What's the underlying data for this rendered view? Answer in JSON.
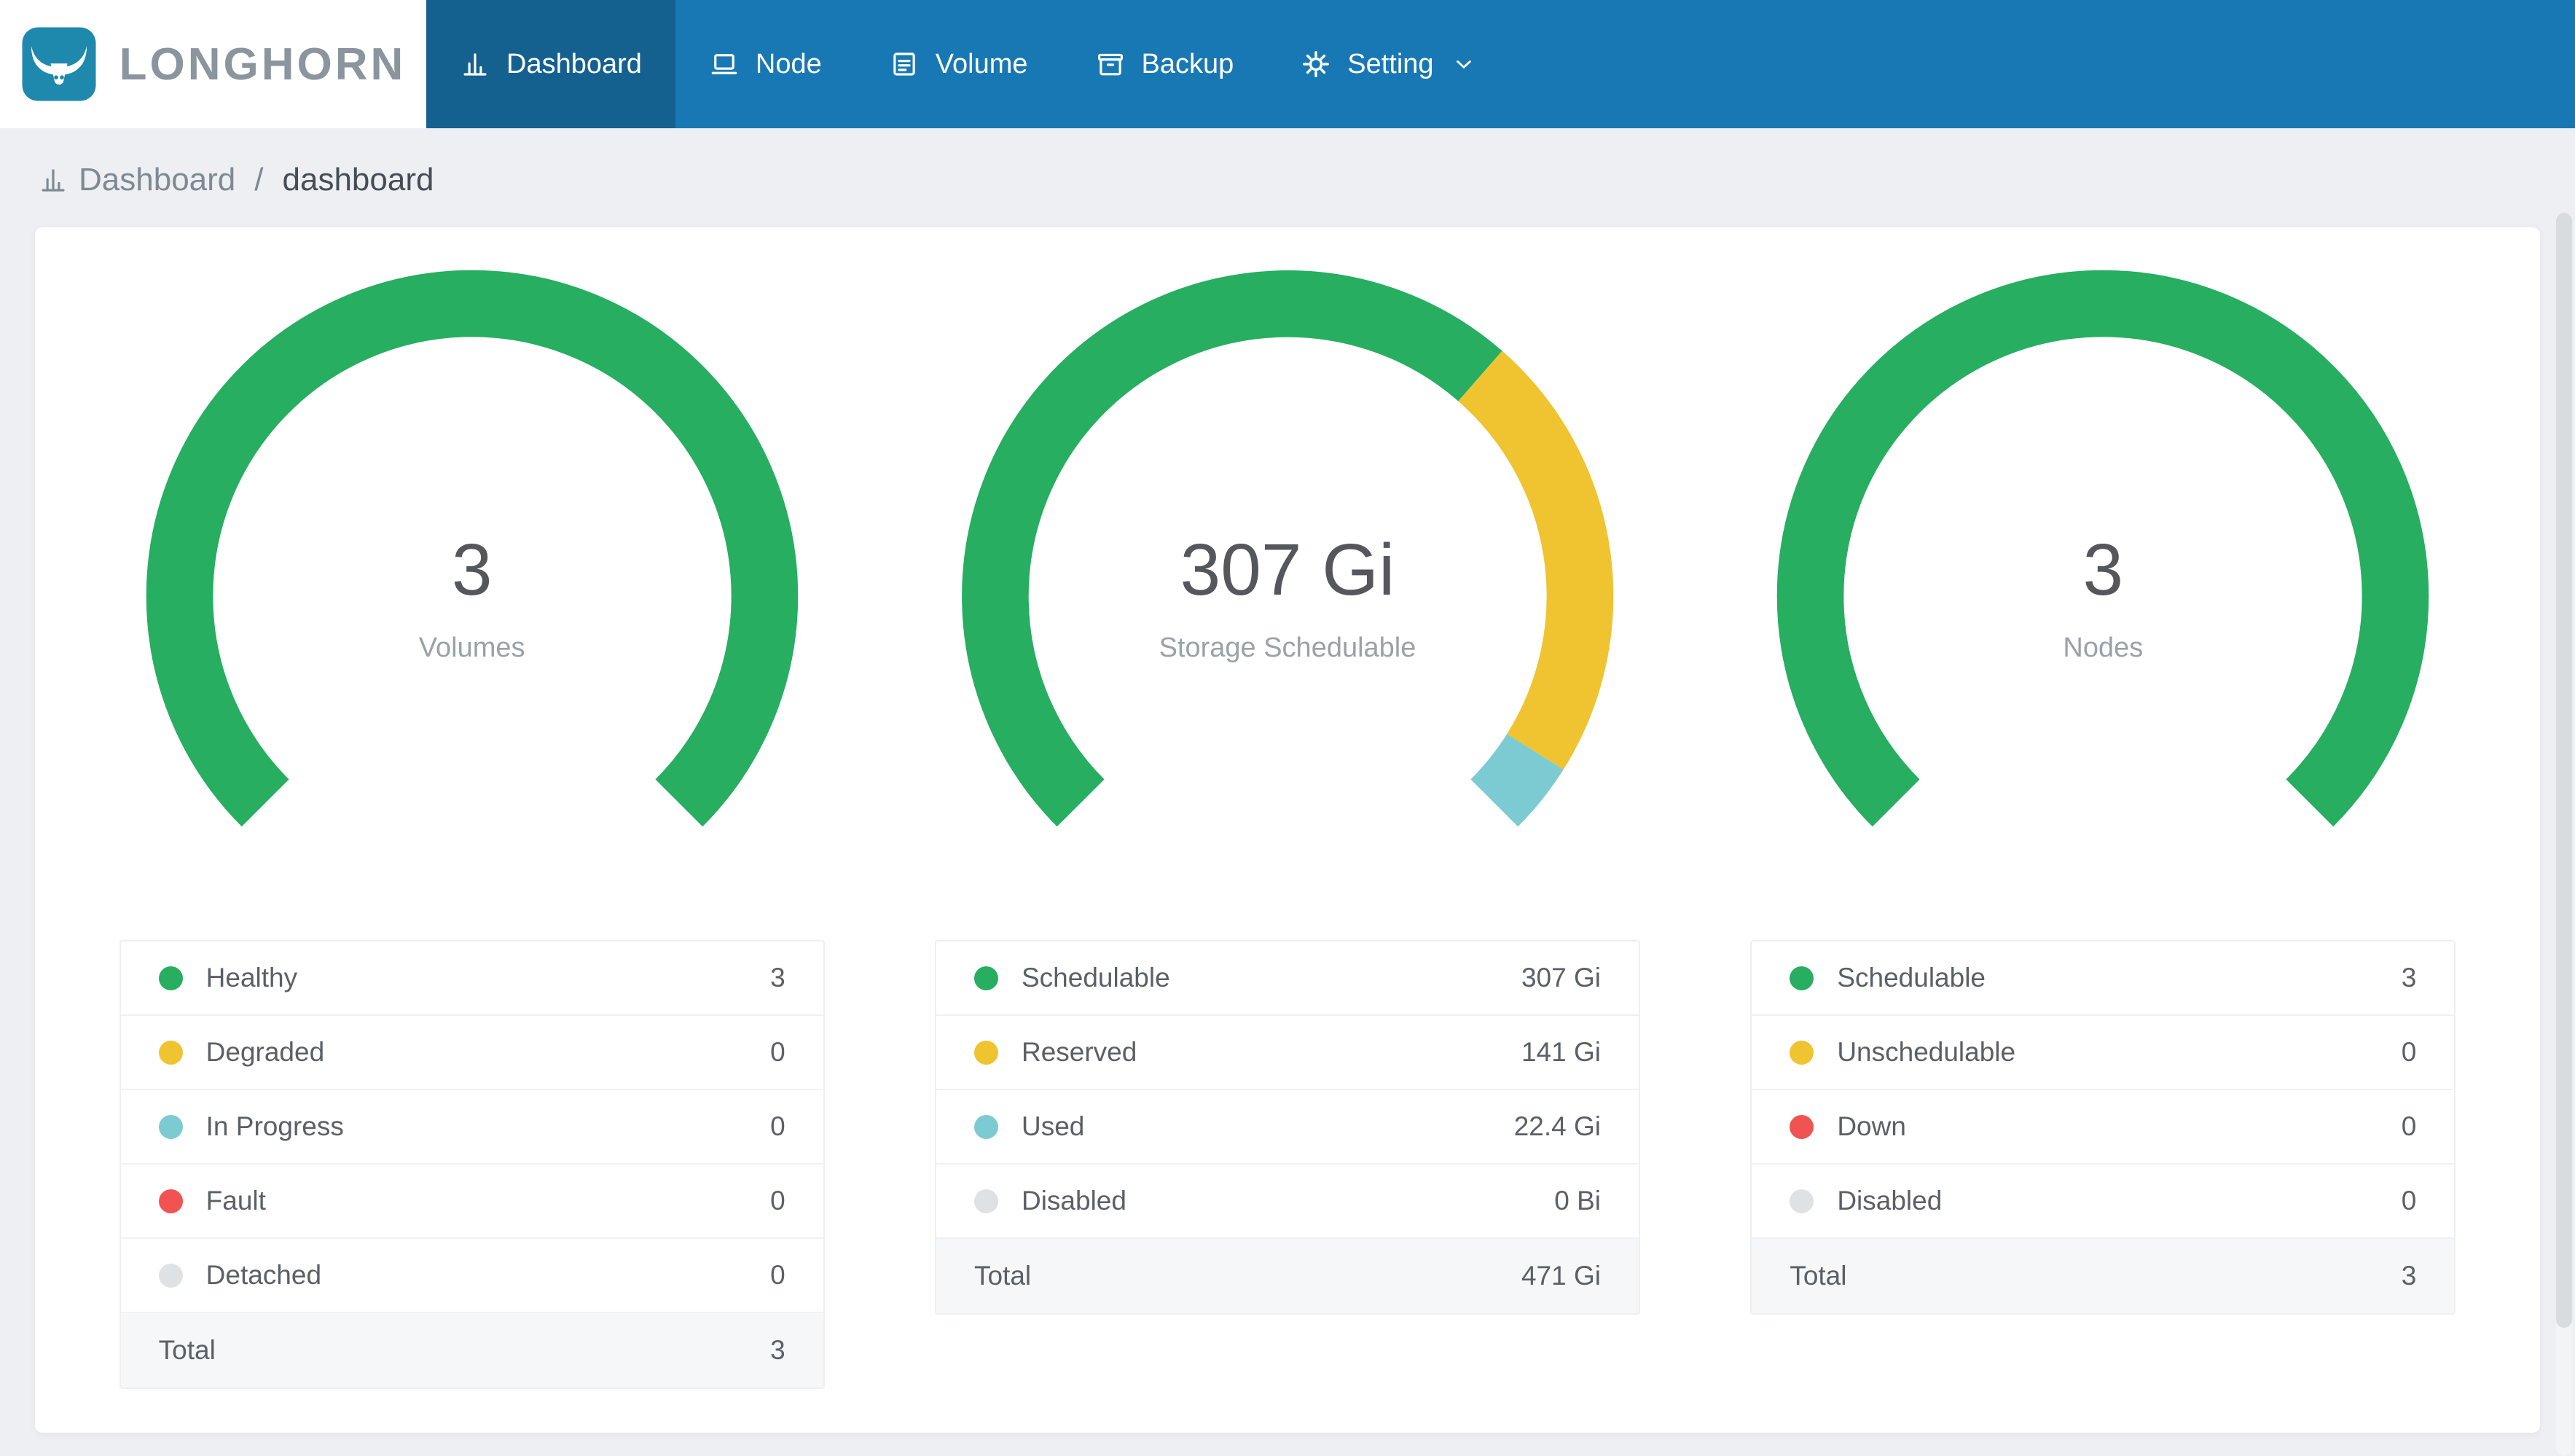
{
  "app": {
    "logo_text": "LONGHORN",
    "logo_icon": "longhorn-bull-icon"
  },
  "nav": {
    "items": [
      {
        "label": "Dashboard",
        "icon": "bar-chart-icon",
        "active": true
      },
      {
        "label": "Node",
        "icon": "laptop-icon",
        "active": false
      },
      {
        "label": "Volume",
        "icon": "list-box-icon",
        "active": false
      },
      {
        "label": "Backup",
        "icon": "archive-box-icon",
        "active": false
      },
      {
        "label": "Setting",
        "icon": "gear-icon",
        "active": false,
        "has_dropdown": true
      }
    ]
  },
  "breadcrumb": {
    "icon": "bar-chart-icon",
    "section": "Dashboard",
    "separator": "/",
    "page": "dashboard"
  },
  "colors": {
    "navbar": "#1878B4",
    "navbar_active": "#14608F",
    "logo_teal": "#1E89AD",
    "green": "#27AE60",
    "yellow": "#F0C330",
    "teal": "#7CCBD3",
    "red": "#F05352",
    "gray": "#DFE2E5"
  },
  "chart_data": [
    {
      "type": "donut-gauge",
      "title": "Volumes",
      "center_value": "3",
      "center_label": "Volumes",
      "gap_degrees": 90,
      "segments": [
        {
          "label": "Healthy",
          "value": 3,
          "display": "3",
          "color": "green"
        },
        {
          "label": "Degraded",
          "value": 0,
          "display": "0",
          "color": "yellow"
        },
        {
          "label": "In Progress",
          "value": 0,
          "display": "0",
          "color": "teal"
        },
        {
          "label": "Fault",
          "value": 0,
          "display": "0",
          "color": "red"
        },
        {
          "label": "Detached",
          "value": 0,
          "display": "0",
          "color": "gray"
        }
      ],
      "total": {
        "label": "Total",
        "display": "3"
      }
    },
    {
      "type": "donut-gauge",
      "title": "Storage Schedulable",
      "center_value": "307 Gi",
      "center_label": "Storage Schedulable",
      "gap_degrees": 90,
      "segments": [
        {
          "label": "Schedulable",
          "value": 307,
          "display": "307 Gi",
          "color": "green"
        },
        {
          "label": "Reserved",
          "value": 141,
          "display": "141 Gi",
          "color": "yellow"
        },
        {
          "label": "Used",
          "value": 22.4,
          "display": "22.4 Gi",
          "color": "teal"
        },
        {
          "label": "Disabled",
          "value": 0,
          "display": "0 Bi",
          "color": "gray"
        }
      ],
      "total": {
        "label": "Total",
        "display": "471 Gi"
      }
    },
    {
      "type": "donut-gauge",
      "title": "Nodes",
      "center_value": "3",
      "center_label": "Nodes",
      "gap_degrees": 90,
      "segments": [
        {
          "label": "Schedulable",
          "value": 3,
          "display": "3",
          "color": "green"
        },
        {
          "label": "Unschedulable",
          "value": 0,
          "display": "0",
          "color": "yellow"
        },
        {
          "label": "Down",
          "value": 0,
          "display": "0",
          "color": "red"
        },
        {
          "label": "Disabled",
          "value": 0,
          "display": "0",
          "color": "gray"
        }
      ],
      "total": {
        "label": "Total",
        "display": "3"
      }
    }
  ]
}
